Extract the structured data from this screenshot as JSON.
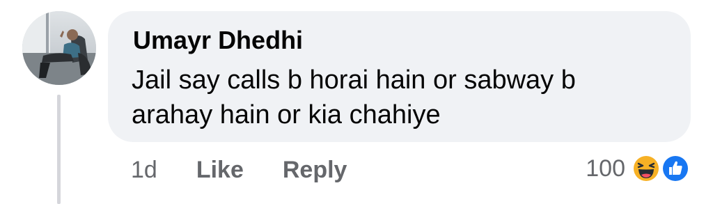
{
  "comment": {
    "author": "Umayr Dhedhi",
    "text": "Jail say calls b horai hain or sabway b arahay hain or kia chahiye",
    "timestamp": "1d",
    "like_label": "Like",
    "reply_label": "Reply",
    "reaction_count": "100",
    "reactions": [
      "haha-icon",
      "like-icon"
    ]
  },
  "colors": {
    "bubble": "#f0f2f5",
    "author_text": "#050505",
    "meta_text": "#65676b",
    "thread_line": "#d5d6db",
    "like_blue": "#1877f2",
    "haha_yellow": "#f7b125"
  }
}
